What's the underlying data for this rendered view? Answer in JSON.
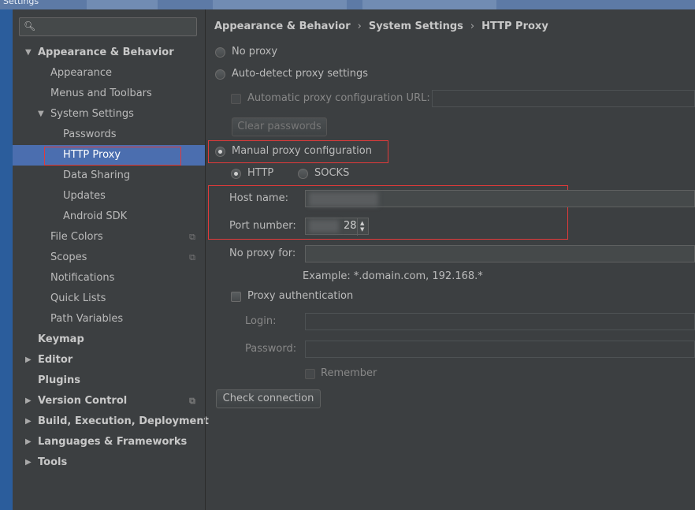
{
  "window": {
    "title": "Settings"
  },
  "breadcrumb": [
    "Appearance & Behavior",
    "System Settings",
    "HTTP Proxy"
  ],
  "sidebar": {
    "search_placeholder": "",
    "items": [
      {
        "label": "Appearance & Behavior",
        "level": 0,
        "bold": true,
        "expanded": true
      },
      {
        "label": "Appearance",
        "level": 1
      },
      {
        "label": "Menus and Toolbars",
        "level": 1
      },
      {
        "label": "System Settings",
        "level": 1,
        "expanded": true
      },
      {
        "label": "Passwords",
        "level": 2
      },
      {
        "label": "HTTP Proxy",
        "level": 2,
        "selected": true
      },
      {
        "label": "Data Sharing",
        "level": 2
      },
      {
        "label": "Updates",
        "level": 2
      },
      {
        "label": "Android SDK",
        "level": 2
      },
      {
        "label": "File Colors",
        "level": 1,
        "project": true
      },
      {
        "label": "Scopes",
        "level": 1,
        "project": true
      },
      {
        "label": "Notifications",
        "level": 1
      },
      {
        "label": "Quick Lists",
        "level": 1
      },
      {
        "label": "Path Variables",
        "level": 1
      },
      {
        "label": "Keymap",
        "level": 0,
        "bold": true
      },
      {
        "label": "Editor",
        "level": 0,
        "bold": true,
        "collapsed": true
      },
      {
        "label": "Plugins",
        "level": 0,
        "bold": true
      },
      {
        "label": "Version Control",
        "level": 0,
        "bold": true,
        "collapsed": true,
        "project": true
      },
      {
        "label": "Build, Execution, Deployment",
        "level": 0,
        "bold": true,
        "collapsed": true
      },
      {
        "label": "Languages & Frameworks",
        "level": 0,
        "bold": true,
        "collapsed": true
      },
      {
        "label": "Tools",
        "level": 0,
        "bold": true,
        "collapsed": true
      }
    ]
  },
  "proxy": {
    "no_proxy_label": "No proxy",
    "auto_detect_label": "Auto-detect proxy settings",
    "auto_url_label": "Automatic proxy configuration URL:",
    "auto_url_value": "",
    "clear_passwords_label": "Clear passwords",
    "manual_label": "Manual proxy configuration",
    "http_label": "HTTP",
    "socks_label": "SOCKS",
    "host_label": "Host name:",
    "host_value": "",
    "port_label": "Port number:",
    "port_value": "28",
    "no_proxy_for_label": "No proxy for:",
    "no_proxy_for_value": "",
    "example_text": "Example: *.domain.com, 192.168.*",
    "auth_label": "Proxy authentication",
    "login_label": "Login:",
    "login_value": "",
    "password_label": "Password:",
    "password_value": "",
    "remember_label": "Remember",
    "check_connection_label": "Check connection",
    "selected_mode": "manual",
    "selected_protocol": "HTTP"
  },
  "colors": {
    "background": "#3c3f41",
    "selection": "#4b6eaf",
    "highlight_box": "#e23a3a"
  }
}
